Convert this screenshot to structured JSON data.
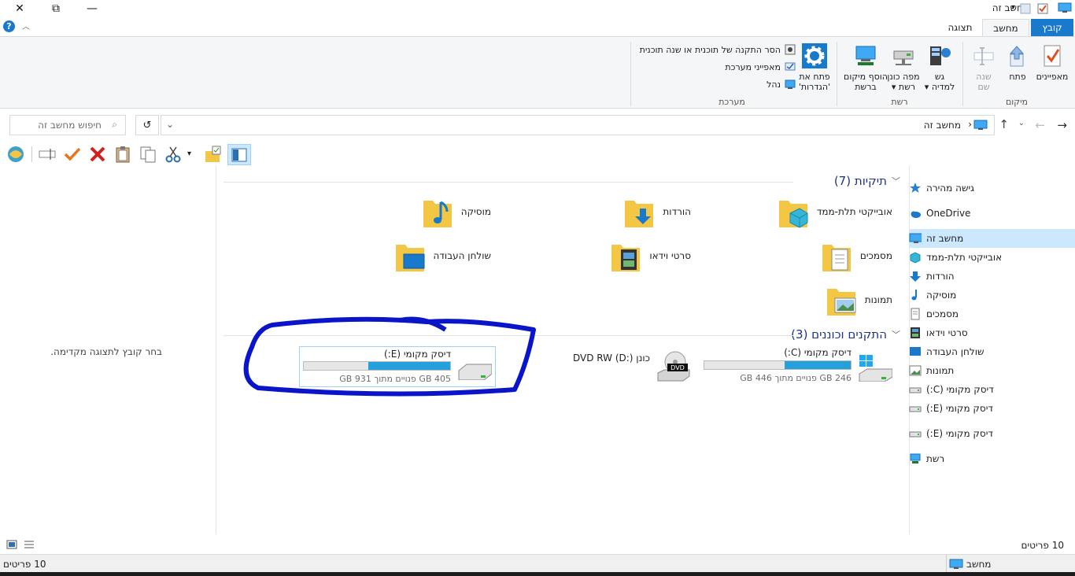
{
  "window": {
    "title": "מחשב זה",
    "close_glyph": "✕",
    "maximize_glyph": "⧉",
    "minimize_glyph": "—"
  },
  "ribbon_tabs": {
    "file": "קובץ",
    "computer": "מחשב",
    "view": "תצוגה"
  },
  "ribbon": {
    "location_group": {
      "label": "מיקום",
      "properties": "מאפיינים",
      "open": "פתח",
      "rename_line1": "שנה",
      "rename_line2": "שם"
    },
    "network_group": {
      "label": "רשת",
      "media_line1": "גש",
      "media_line2": "למדיה",
      "map_line1": "מפה כונן",
      "map_line2": "רשת",
      "add_line1": "הוסף מיקום",
      "add_line2": "ברשת"
    },
    "system_group": {
      "label": "מערכת",
      "settings_line1": "פתח את",
      "settings_line2": "'הגדרות'",
      "uninstall": "הסר התקנה של תוכנית או שנה תוכנית",
      "system_props": "מאפייני מערכת",
      "manage": "נהל"
    }
  },
  "address": {
    "path_label": "מחשב זה",
    "separator": "›",
    "refresh_glyph": "↺",
    "search_placeholder": "חיפוש מחשב זה"
  },
  "preview": {
    "message": "בחר קובץ לתצוגה מקדימה."
  },
  "folders_section": {
    "title": "תיקיות (7)",
    "items": [
      {
        "label": "אובייקטי תלת-ממד",
        "icon": "3d-objects-folder-icon"
      },
      {
        "label": "הורדות",
        "icon": "downloads-folder-icon"
      },
      {
        "label": "מוסיקה",
        "icon": "music-folder-icon"
      },
      {
        "label": "מסמכים",
        "icon": "documents-folder-icon"
      },
      {
        "label": "סרטי וידאו",
        "icon": "videos-folder-icon"
      },
      {
        "label": "שולחן העבודה",
        "icon": "desktop-folder-icon"
      },
      {
        "label": "תמונות",
        "icon": "pictures-folder-icon"
      }
    ]
  },
  "drives_section": {
    "title": "התקנים וכוננים (3)",
    "items": [
      {
        "label": "דיסק מקומי (C:)",
        "sub": "246 GB פנויים מתוך 446 GB",
        "used_fraction": 0.45
      },
      {
        "label": "כונן DVD RW (D:)",
        "sub": "",
        "badge": "DVD"
      },
      {
        "label": "דיסק מקומי (E:)",
        "sub": "405 GB פנויים מתוך 931 GB",
        "used_fraction": 0.56
      }
    ]
  },
  "nav": {
    "items": [
      {
        "label": "גישה מהירה",
        "icon": "star-icon"
      },
      {
        "label": "OneDrive",
        "icon": "cloud-icon"
      },
      {
        "label": "מחשב זה",
        "icon": "computer-icon"
      },
      {
        "label": "אובייקטי תלת-ממד",
        "icon": "cube-icon"
      },
      {
        "label": "הורדות",
        "icon": "download-arrow-icon"
      },
      {
        "label": "מוסיקה",
        "icon": "music-note-icon"
      },
      {
        "label": "מסמכים",
        "icon": "document-icon"
      },
      {
        "label": "סרטי וידאו",
        "icon": "film-icon"
      },
      {
        "label": "שולחן העבודה",
        "icon": "desktop-icon"
      },
      {
        "label": "תמונות",
        "icon": "picture-icon"
      },
      {
        "label": "דיסק מקומי (C:)",
        "icon": "drive-icon"
      },
      {
        "label": "דיסק מקומי (E:)",
        "icon": "drive-icon"
      },
      {
        "label": "דיסק מקומי (E:)",
        "icon": "drive-icon"
      },
      {
        "label": "רשת",
        "icon": "network-icon"
      }
    ]
  },
  "status": {
    "count_text": "10 פריטים",
    "taskbar_count": "10 פריטים",
    "taskbar_location": "מחשב"
  },
  "colors": {
    "accent": "#1979ca",
    "selection": "#cce8ff",
    "drive_bar": "#26a0da",
    "annotation": "#0a14c8",
    "folder": "#f3c643"
  }
}
